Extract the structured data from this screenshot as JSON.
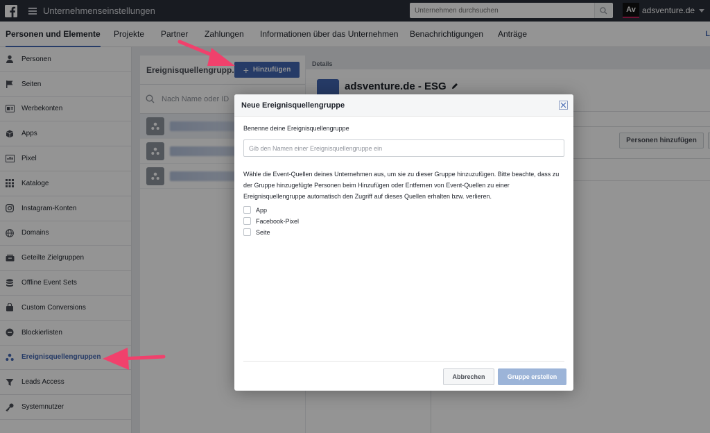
{
  "topbar": {
    "title": "Unternehmenseinstellungen",
    "search_placeholder": "Unternehmen durchsuchen",
    "account_logo": "Av",
    "account_name": "adsventure.de"
  },
  "tabs": [
    {
      "label": "Personen und Elemente",
      "active": true
    },
    {
      "label": "Projekte"
    },
    {
      "label": "Partner"
    },
    {
      "label": "Zahlungen"
    },
    {
      "label": "Informationen über das Unternehmen"
    },
    {
      "label": "Benachrichtigungen"
    },
    {
      "label": "Anträge"
    }
  ],
  "tabs_right": "L",
  "sidebar": {
    "items": [
      {
        "label": "Personen",
        "icon": "person-icon"
      },
      {
        "label": "Seiten",
        "icon": "flag-icon"
      },
      {
        "label": "Werbekonten",
        "icon": "ad-account-icon"
      },
      {
        "label": "Apps",
        "icon": "cube-icon"
      },
      {
        "label": "Pixel",
        "icon": "pixel-icon"
      },
      {
        "label": "Kataloge",
        "icon": "grid-icon"
      },
      {
        "label": "Instagram-Konten",
        "icon": "instagram-icon"
      },
      {
        "label": "Domains",
        "icon": "globe-icon"
      },
      {
        "label": "Geteilte Zielgruppen",
        "icon": "shared-audience-icon"
      },
      {
        "label": "Offline Event Sets",
        "icon": "database-icon"
      },
      {
        "label": "Custom Conversions",
        "icon": "conversion-icon"
      },
      {
        "label": "Blockierlisten",
        "icon": "block-icon"
      },
      {
        "label": "Ereignisquellengruppen",
        "icon": "event-group-icon",
        "active": true
      },
      {
        "label": "Leads Access",
        "icon": "funnel-icon"
      },
      {
        "label": "Systemnutzer",
        "icon": "key-icon"
      }
    ]
  },
  "middle": {
    "header": "Ereignisquellengrupp...",
    "add_button": "Hinzufügen",
    "search_placeholder": "Nach Name oder ID"
  },
  "details": {
    "label": "Details",
    "title": "adsventure.de - ESG",
    "persons_button": "Personen hinzufügen"
  },
  "modal": {
    "title": "Neue Ereignisquellengruppe",
    "name_label": "Benenne deine Ereignisquellengruppe",
    "name_placeholder": "Gib den Namen einer Ereignisquellengruppe ein",
    "description": "Wähle die Event-Quellen deines Unternehmen aus, um sie zu dieser Gruppe hinzuzufügen. Bitte beachte, dass zu der Gruppe hinzugefügte Personen beim Hinzufügen oder Entfernen von Event-Quellen zu einer Ereignisquellengruppe automatisch den Zugriff auf dieses Quellen erhalten bzw. verlieren.",
    "options": [
      "App",
      "Facebook-Pixel",
      "Seite"
    ],
    "cancel_button": "Abbrechen",
    "create_button": "Gruppe erstellen"
  },
  "colors": {
    "accent": "#4267b2",
    "annotation_arrow": "#f0416c"
  }
}
